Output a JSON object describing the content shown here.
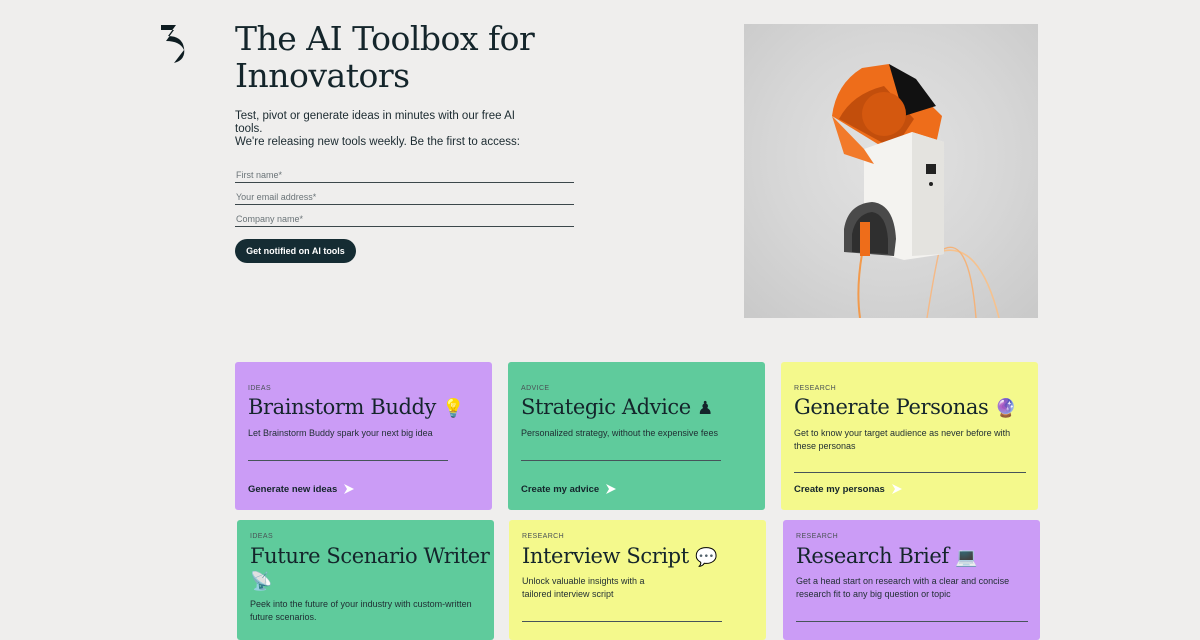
{
  "hero": {
    "title": "The AI Toolbox for Innovators",
    "desc_line1": "Test, pivot or generate ideas in minutes with our free AI tools.",
    "desc_line2": "We're releasing new tools weekly. Be the first to access:"
  },
  "form": {
    "first_name_placeholder": "First name*",
    "email_placeholder": "Your email address*",
    "company_placeholder": "Company name*",
    "submit_label": "Get notified on AI tools"
  },
  "cards": [
    {
      "tag": "IDEAS",
      "title": "Brainstorm Buddy",
      "emoji": "💡",
      "desc": "Let Brainstorm Buddy spark your next big idea",
      "link": "Generate new ideas",
      "color": "#cb9cf6"
    },
    {
      "tag": "ADVICE",
      "title": "Strategic Advice",
      "emoji": "♟",
      "desc": "Personalized strategy, without the expensive fees",
      "link": "Create my advice",
      "color": "#5fcb9c"
    },
    {
      "tag": "RESEARCH",
      "title": "Generate Personas",
      "emoji": "🔮",
      "desc": "Get to know your target audience as never before with these personas",
      "link": "Create my personas",
      "color": "#f4f98c"
    },
    {
      "tag": "IDEAS",
      "title": "Future Scenario Writer",
      "emoji": "📡",
      "desc": "Peek into the future of your industry with custom-written future scenarios.",
      "link": "",
      "color": "#5fcb9c"
    },
    {
      "tag": "RESEARCH",
      "title": "Interview Script",
      "emoji": "💬",
      "desc": "Unlock valuable insights with a tailored interview script",
      "link": "",
      "color": "#f4f98c"
    },
    {
      "tag": "RESEARCH",
      "title": "Research Brief",
      "emoji": "💻",
      "desc": "Get a head start on research with a clear and concise research fit to any big question or topic",
      "link": "",
      "color": "#cb9cf6"
    }
  ]
}
